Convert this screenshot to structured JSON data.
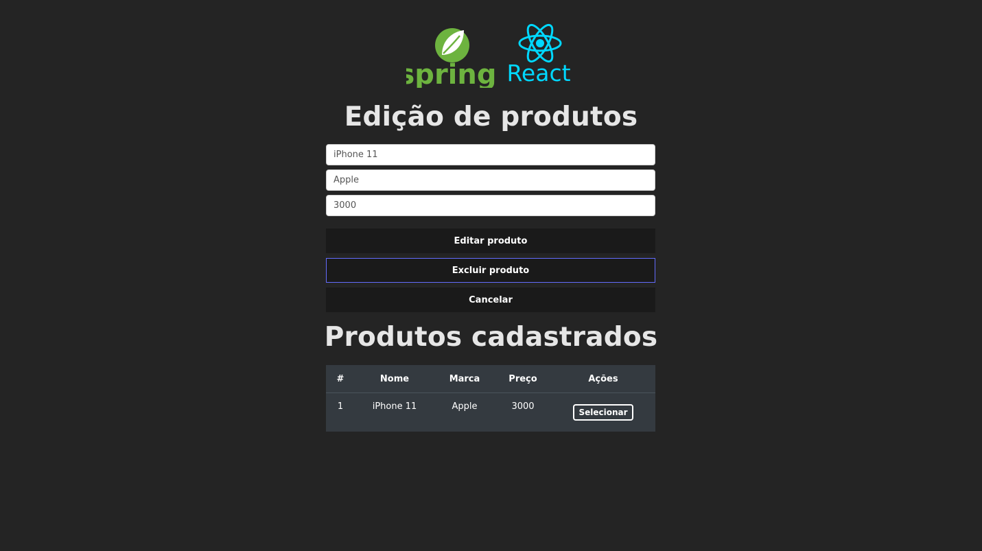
{
  "logos": {
    "spring_text": "spring",
    "react_text": "React",
    "spring_color": "#6db33f",
    "react_color": "#00d8ff"
  },
  "edit_section": {
    "title": "Edição de produtos",
    "fields": {
      "name_value": "iPhone 11",
      "brand_value": "Apple",
      "price_value": "3000"
    },
    "buttons": {
      "edit_label": "Editar produto",
      "delete_label": "Excluir produto",
      "cancel_label": "Cancelar"
    }
  },
  "list_section": {
    "title": "Produtos cadastrados",
    "columns": [
      "#",
      "Nome",
      "Marca",
      "Preço",
      "Ações"
    ],
    "rows": [
      {
        "index": "1",
        "name": "iPhone 11",
        "brand": "Apple",
        "price": "3000",
        "action_label": "Selecionar"
      }
    ]
  },
  "colors": {
    "background": "#242424",
    "button_bg": "#1a1a1a",
    "focus_border": "#646cff",
    "table_bg": "#343a40"
  }
}
